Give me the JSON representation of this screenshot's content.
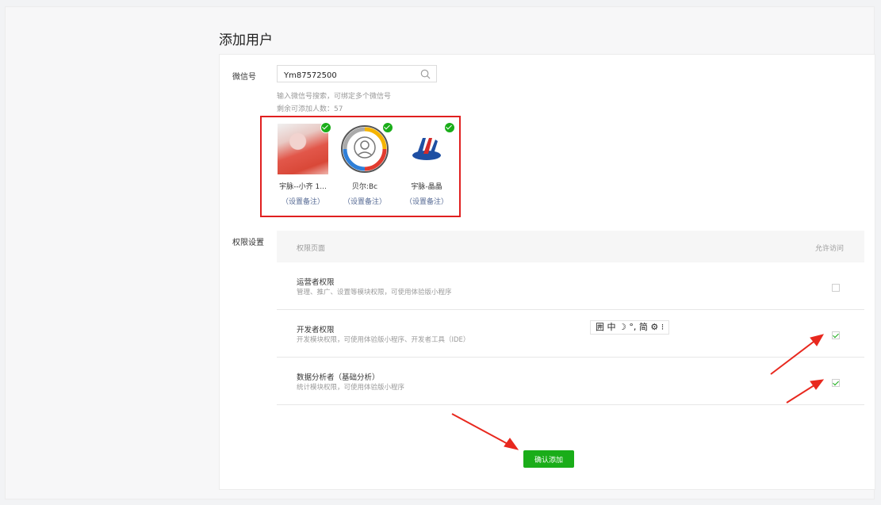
{
  "page": {
    "title": "添加用户"
  },
  "wechat": {
    "label": "微信号",
    "input_value": "Ym87572500",
    "hint": "输入微信号搜索，可绑定多个微信号",
    "remaining": "剩余可添加人数：57"
  },
  "users": [
    {
      "name": "宇脉--小齐 1...",
      "note_link": "（设置备注）"
    },
    {
      "name": "贝尔:Bc",
      "note_link": "（设置备注）"
    },
    {
      "name": "宇脉-晶晶",
      "note_link": "（设置备注）"
    }
  ],
  "permissions": {
    "label": "权限设置",
    "col_page": "权限页面",
    "col_allow": "允许访问",
    "rows": [
      {
        "title": "运营者权限",
        "desc": "管理、推广、设置等模块权限，可使用体验版小程序",
        "checked": false
      },
      {
        "title": "开发者权限",
        "desc": "开发模块权限，可使用体验版小程序、开发者工具（IDE）",
        "checked": true
      },
      {
        "title": "数据分析者（基础分析）",
        "desc": "统计模块权限，可使用体验版小程序",
        "checked": true
      }
    ]
  },
  "ime_toolbar": "囲 中 ☽ °, 简 ⚙ ⁝",
  "confirm_label": "确认添加",
  "colors": {
    "accent": "#1aad19",
    "link": "#576b95",
    "highlight_box": "#e02020",
    "arrow": "#e8281e"
  }
}
